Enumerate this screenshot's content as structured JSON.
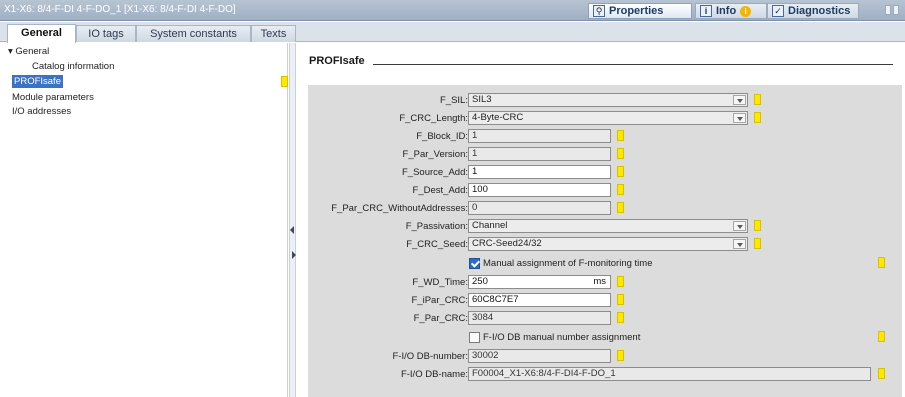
{
  "window": {
    "title": "X1-X6: 8/4-F-DI 4-F-DO_1 [X1-X6: 8/4-F-DI 4-F-DO]",
    "properties_label": "Properties",
    "info_label": "Info",
    "diagnostics_label": "Diagnostics"
  },
  "tabs": [
    "General",
    "IO tags",
    "System constants",
    "Texts"
  ],
  "tree": {
    "group": "General",
    "items": [
      "Catalog information",
      "PROFIsafe",
      "Module parameters",
      "I/O addresses"
    ]
  },
  "section": {
    "title": "PROFIsafe"
  },
  "fields": [
    {
      "label": "F_SIL:",
      "value": "SIL3"
    },
    {
      "label": "F_CRC_Length:",
      "value": "4-Byte-CRC"
    },
    {
      "label": "F_Block_ID:",
      "value": "1"
    },
    {
      "label": "F_Par_Version:",
      "value": "1"
    },
    {
      "label": "F_Source_Add:",
      "value": "1"
    },
    {
      "label": "F_Dest_Add:",
      "value": "100"
    },
    {
      "label": "F_Par_CRC_WithoutAddresses:",
      "value": "0"
    },
    {
      "label": "F_Passivation:",
      "value": "Channel"
    },
    {
      "label": "F_CRC_Seed:",
      "value": "CRC-Seed24/32"
    },
    {
      "label": "F_WD_Time:",
      "value": "250",
      "unit": "ms"
    },
    {
      "label": "F_iPar_CRC:",
      "value": "60C8C7E7"
    },
    {
      "label": "F_Par_CRC:",
      "value": "3084"
    },
    {
      "label": "F-I/O DB-number:",
      "value": "30002"
    },
    {
      "label": "F-I/O DB-name:",
      "value": "F00004_X1-X6:8/4-F-DI4-F-DO_1"
    }
  ],
  "checkboxes": {
    "manual_monitoring": {
      "label": "Manual assignment of F-monitoring time",
      "checked": true
    },
    "manual_db_number": {
      "label": "F-I/O DB manual number assignment",
      "checked": false
    }
  },
  "colors": {
    "flag": "#ffe800",
    "selection": "#3a73c6",
    "panel": "#dcdcdc"
  }
}
